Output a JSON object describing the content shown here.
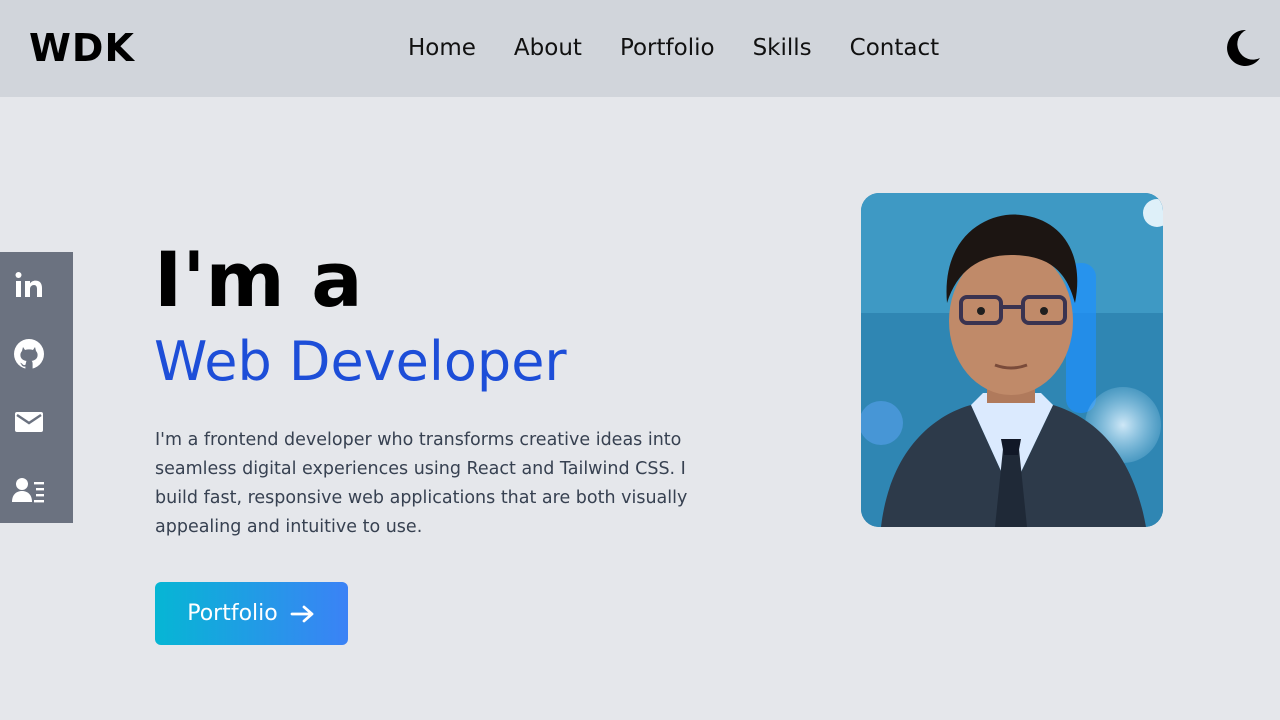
{
  "header": {
    "logo": "WDK",
    "nav": [
      {
        "label": "Home"
      },
      {
        "label": "About"
      },
      {
        "label": "Portfolio"
      },
      {
        "label": "Skills"
      },
      {
        "label": "Contact"
      }
    ],
    "theme_toggle_icon": "moon-icon"
  },
  "social": {
    "items": [
      {
        "icon": "linkedin-icon"
      },
      {
        "icon": "github-icon"
      },
      {
        "icon": "email-icon"
      },
      {
        "icon": "resume-icon"
      }
    ]
  },
  "hero": {
    "line1": "I'm a",
    "line2": "Web Developer",
    "description": "I'm a frontend developer who transforms creative ideas into seamless digital experiences using React and Tailwind CSS. I build fast, responsive web applications that are both visually appealing and intuitive to use.",
    "cta_label": "Portfolio",
    "cta_icon": "arrow-right-icon"
  },
  "colors": {
    "page_bg": "#e5e7eb",
    "header_bg": "#d1d5db",
    "sidebar_bg": "#6b7280",
    "accent": "#1d4ed8",
    "cta_gradient_start": "#06b6d4",
    "cta_gradient_end": "#3b82f6"
  }
}
